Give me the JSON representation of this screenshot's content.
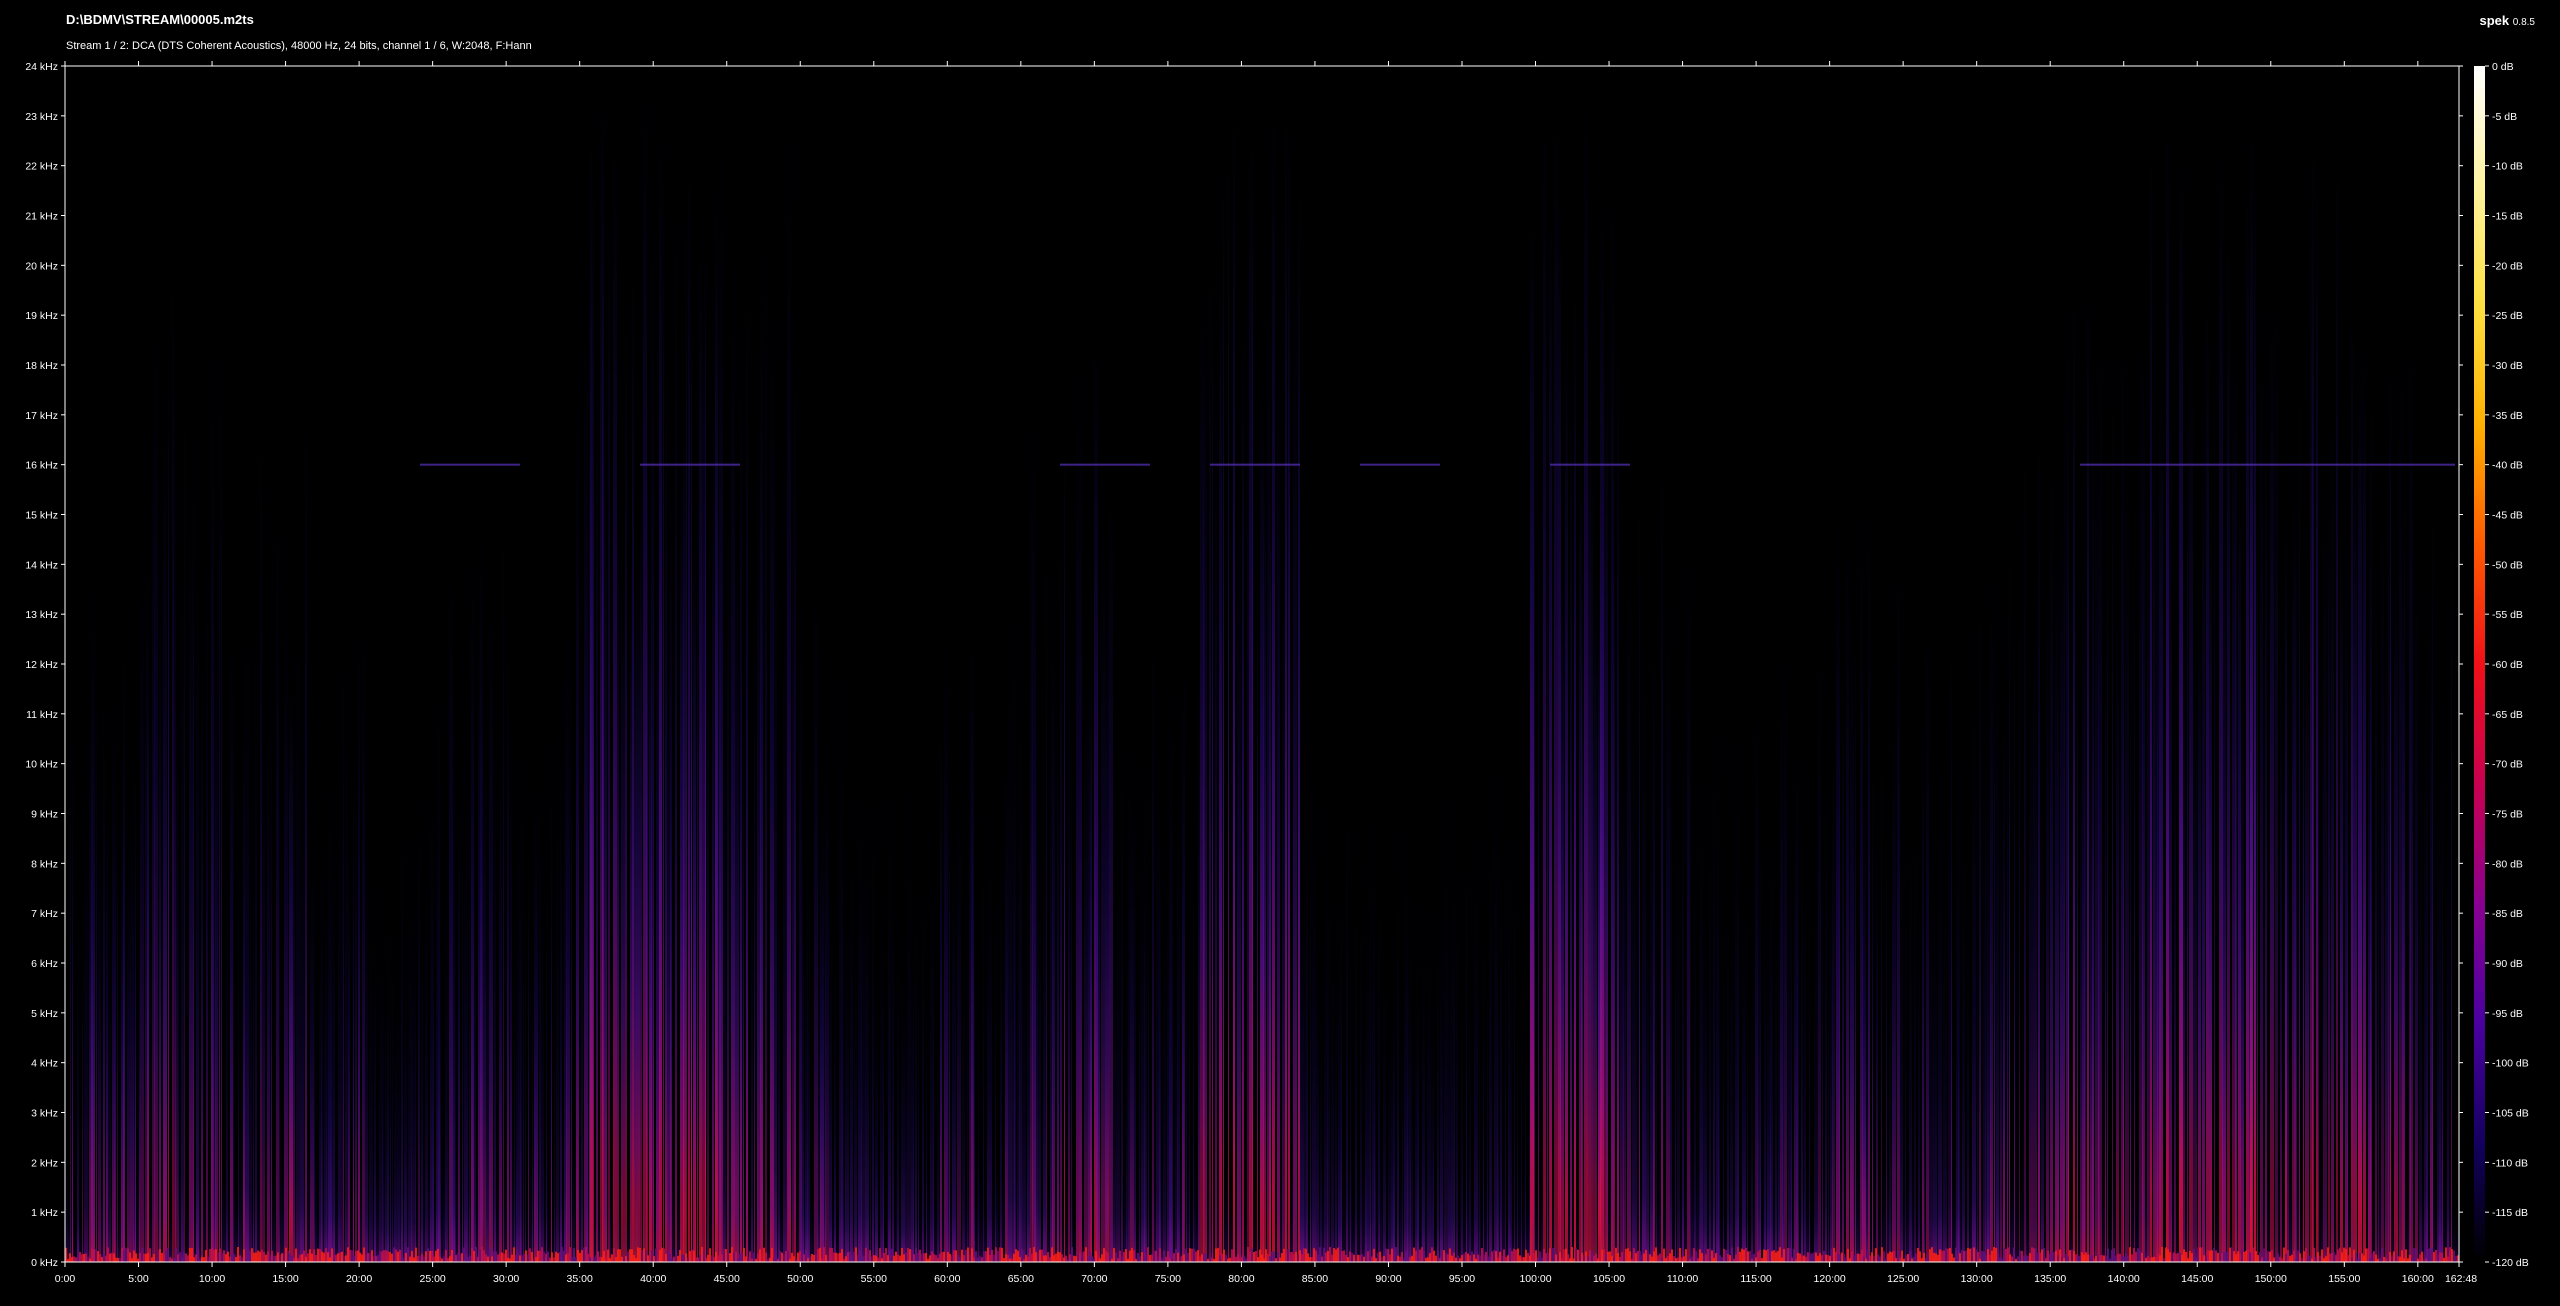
{
  "app": {
    "name": "spek",
    "version": "0.8.5"
  },
  "file": {
    "path": "D:\\BDMV\\STREAM\\00005.m2ts",
    "stream_info": "Stream 1 / 2: DCA (DTS Coherent Acoustics), 48000 Hz, 24 bits, channel 1 / 6, W:2048, F:Hann"
  },
  "spectrogram": {
    "freq_axis": {
      "unit": "kHz",
      "min": 0,
      "max": 24,
      "labels": [
        "0 kHz",
        "1 kHz",
        "2 kHz",
        "3 kHz",
        "4 kHz",
        "5 kHz",
        "6 kHz",
        "7 kHz",
        "8 kHz",
        "9 kHz",
        "10 kHz",
        "11 kHz",
        "12 kHz",
        "13 kHz",
        "14 kHz",
        "15 kHz",
        "16 kHz",
        "17 kHz",
        "18 kHz",
        "19 kHz",
        "20 kHz",
        "21 kHz",
        "22 kHz",
        "23 kHz",
        "24 kHz"
      ]
    },
    "time_axis": {
      "end_label": "162:48",
      "labels": [
        "0:00",
        "5:00",
        "10:00",
        "15:00",
        "20:00",
        "25:00",
        "30:00",
        "35:00",
        "40:00",
        "45:00",
        "50:00",
        "55:00",
        "60:00",
        "65:00",
        "70:00",
        "75:00",
        "80:00",
        "85:00",
        "90:00",
        "95:00",
        "100:00",
        "105:00",
        "110:00",
        "115:00",
        "120:00",
        "125:00",
        "130:00",
        "135:00",
        "140:00",
        "145:00",
        "150:00",
        "155:00",
        "160:00"
      ]
    },
    "db_scale": {
      "labels": [
        "0 dB",
        "-5 dB",
        "-10 dB",
        "-15 dB",
        "-20 dB",
        "-25 dB",
        "-30 dB",
        "-35 dB",
        "-40 dB",
        "-45 dB",
        "-50 dB",
        "-55 dB",
        "-60 dB",
        "-65 dB",
        "-70 dB",
        "-75 dB",
        "-80 dB",
        "-85 dB",
        "-90 dB",
        "-95 dB",
        "-100 dB",
        "-105 dB",
        "-110 dB",
        "-115 dB",
        "-120 dB"
      ],
      "colors": [
        "#ffffff",
        "#fff3a0",
        "#ffe040",
        "#ffb000",
        "#ff5a00",
        "#f01018",
        "#c80050",
        "#8a0090",
        "#4a00a0",
        "#140060",
        "#000000"
      ]
    },
    "colors": {
      "axis": "#ffffff",
      "background": "#000000",
      "band_line": "#5a30c0"
    }
  }
}
